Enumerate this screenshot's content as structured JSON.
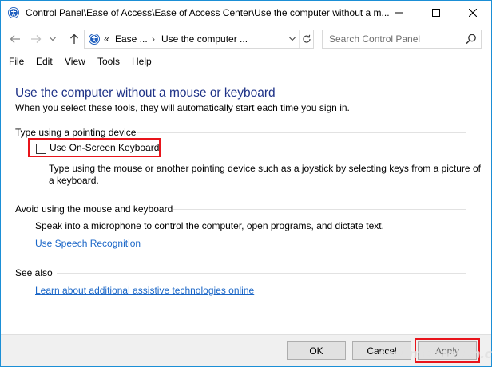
{
  "window": {
    "title": "Control Panel\\Ease of Access\\Ease of Access Center\\Use the computer without a m...",
    "accent_color": "#1b8fd6"
  },
  "address": {
    "prefix": "«",
    "segment_1": "Ease ...",
    "separator": "›",
    "segment_2": "Use the computer ...",
    "search_placeholder": "Search Control Panel"
  },
  "menu": {
    "items": [
      "File",
      "Edit",
      "View",
      "Tools",
      "Help"
    ]
  },
  "page": {
    "title": "Use the computer without a mouse or keyboard",
    "subtitle": "When you select these tools, they will automatically start each time you sign in.",
    "title_color": "#1e3287"
  },
  "pointing": {
    "heading": "Type using a pointing device",
    "checkbox_label": "Use On-Screen Keyboard",
    "checkbox_checked": false,
    "description": "Type using the mouse or another pointing device such as a joystick by selecting keys from a picture of a keyboard."
  },
  "avoid": {
    "heading": "Avoid using the mouse and keyboard",
    "description": "Speak into a microphone to control the computer, open programs, and dictate text.",
    "link": "Use Speech Recognition"
  },
  "see_also": {
    "heading": "See also",
    "link": "Learn about additional assistive technologies online"
  },
  "footer": {
    "ok": "OK",
    "cancel": "Cancel",
    "apply": "Apply",
    "watermark": "sasantehzosbn.com"
  },
  "highlight_color": "#e8141b",
  "link_color": "#1a66c7"
}
